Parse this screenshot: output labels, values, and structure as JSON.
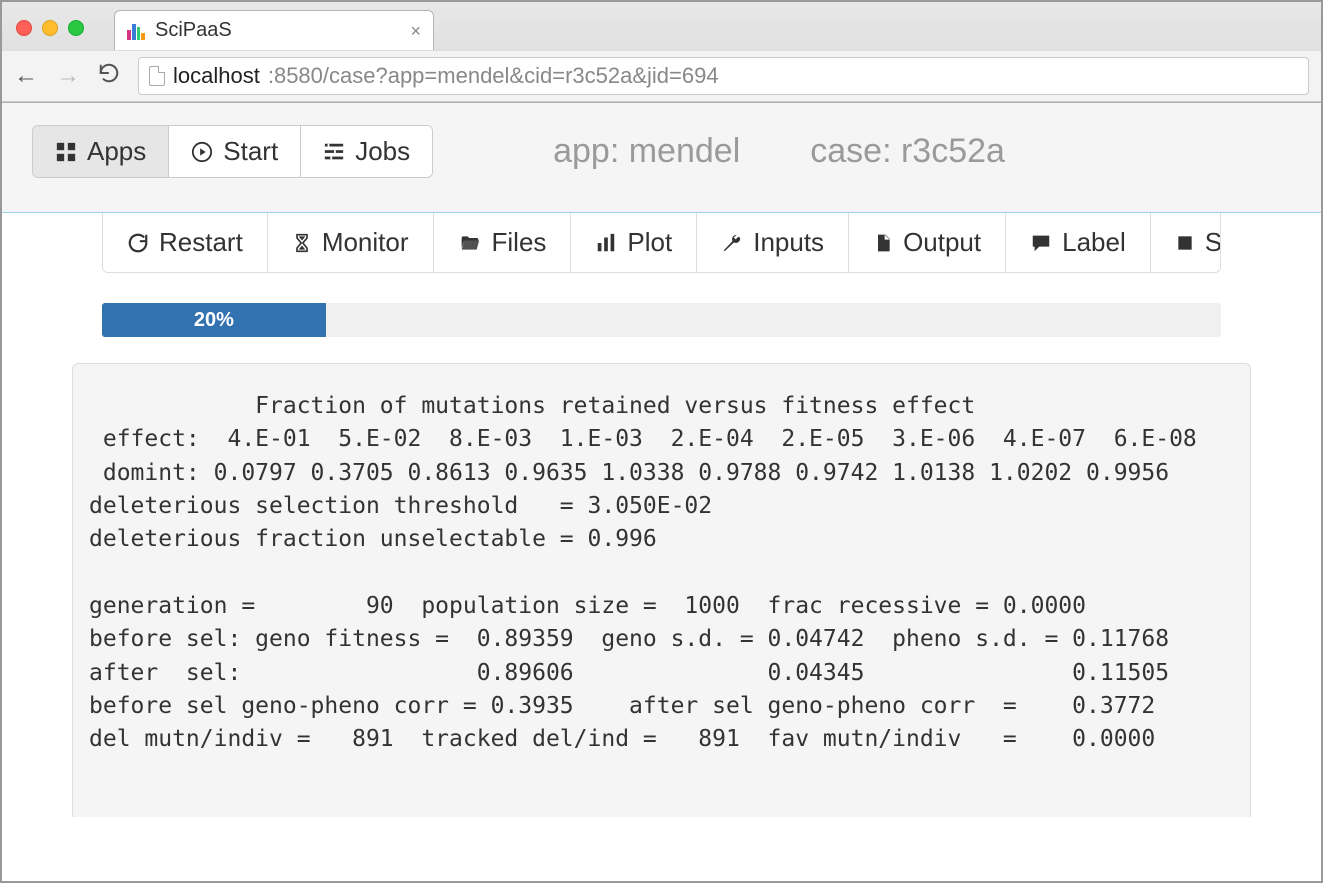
{
  "browser": {
    "tab_title": "SciPaaS",
    "url_host": "localhost",
    "url_rest": ":8580/case?app=mendel&cid=r3c52a&jid=694"
  },
  "toolbar": {
    "apps_label": "Apps",
    "start_label": "Start",
    "jobs_label": "Jobs"
  },
  "meta": {
    "app_label": "app: mendel",
    "case_label": "case: r3c52a"
  },
  "case_actions": {
    "restart": "Restart",
    "monitor": "Monitor",
    "files": "Files",
    "plot": "Plot",
    "inputs": "Inputs",
    "output": "Output",
    "label": "Label",
    "stop": "Stop"
  },
  "progress": {
    "percent": 20,
    "text": "20%"
  },
  "console_output": "            Fraction of mutations retained versus fitness effect\n effect:  4.E-01  5.E-02  8.E-03  1.E-03  2.E-04  2.E-05  3.E-06  4.E-07  6.E-08\n domint: 0.0797 0.3705 0.8613 0.9635 1.0338 0.9788 0.9742 1.0138 1.0202 0.9956\ndeleterious selection threshold   = 3.050E-02\ndeleterious fraction unselectable = 0.996\n\ngeneration =        90  population size =  1000  frac recessive = 0.0000\nbefore sel: geno fitness =  0.89359  geno s.d. = 0.04742  pheno s.d. = 0.11768\nafter  sel:                 0.89606              0.04345               0.11505\nbefore sel geno-pheno corr = 0.3935    after sel geno-pheno corr  =    0.3772\ndel mutn/indiv =   891  tracked del/ind =   891  fav mutn/indiv   =    0.0000"
}
